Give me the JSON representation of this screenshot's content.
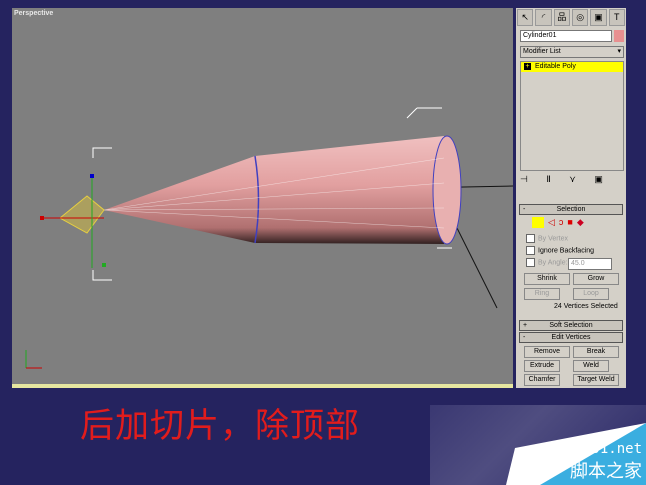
{
  "viewport": {
    "label": "Perspective"
  },
  "panel": {
    "tabs": [
      "create-icon",
      "modify-icon",
      "hierarchy-icon",
      "motion-icon",
      "display-icon",
      "utilities-icon"
    ],
    "object_name": "Cylinder01",
    "object_color": "#e89090",
    "modifier_list": "Modifier List",
    "stack_item": "Editable Poly",
    "selection": {
      "title": "Selection",
      "by_vertex": "By Vertex",
      "ignore_backfacing": "Ignore Backfacing",
      "by_angle": "By Angle:",
      "angle_value": "45.0",
      "shrink": "Shrink",
      "grow": "Grow",
      "ring": "Ring",
      "loop": "Loop",
      "status": "24 Vertices Selected"
    },
    "soft_selection": {
      "title": "Soft Selection",
      "toggle": "+"
    },
    "edit_vertices": {
      "title": "Edit Vertices",
      "toggle": "-",
      "remove": "Remove",
      "break": "Break",
      "extrude": "Extrude",
      "weld": "Weld",
      "chamfer": "Chamfer",
      "target_weld": "Target Weld"
    }
  },
  "caption": "后加切片，除顶部",
  "watermark": {
    "url": "jb51.net",
    "name": "脚本之家"
  }
}
